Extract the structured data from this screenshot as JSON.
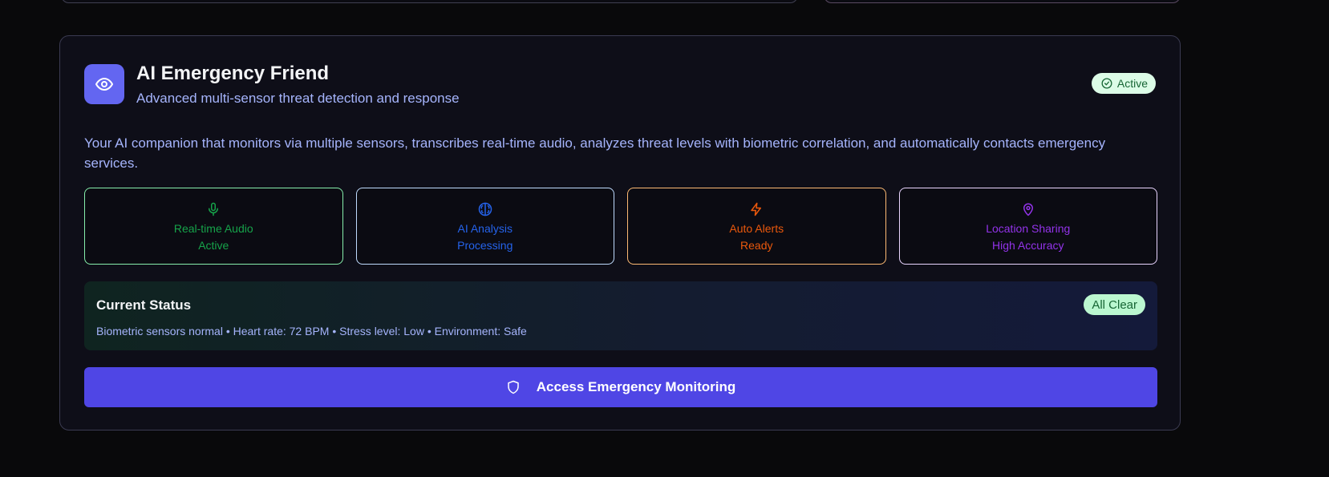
{
  "card": {
    "title": "AI Emergency Friend",
    "subtitle": "Advanced multi-sensor threat detection and response",
    "badge": "Active",
    "description": "Your AI companion that monitors via multiple sensors, transcribes real-time audio, analyzes threat levels with biometric correlation, and automatically contacts emergency services.",
    "header_icon": "eye-icon",
    "badge_icon": "check-circle-icon"
  },
  "features": [
    {
      "name": "Real-time Audio",
      "status": "Active",
      "icon": "microphone-icon",
      "color": "#16a34a"
    },
    {
      "name": "AI Analysis",
      "status": "Processing",
      "icon": "brain-icon",
      "color": "#2563eb"
    },
    {
      "name": "Auto Alerts",
      "status": "Ready",
      "icon": "lightning-icon",
      "color": "#ea580c"
    },
    {
      "name": "Location Sharing",
      "status": "High Accuracy",
      "icon": "map-pin-icon",
      "color": "#9333ea"
    }
  ],
  "status": {
    "title": "Current Status",
    "badge": "All Clear",
    "details": "Biometric sensors normal • Heart rate: 72 BPM • Stress level: Low • Environment: Safe"
  },
  "cta": {
    "label": "Access Emergency Monitoring",
    "icon": "shield-icon"
  },
  "colors": {
    "accent": "#4f46e5",
    "icon_bg": "#6366f1",
    "success_bg": "#dcfce7"
  }
}
